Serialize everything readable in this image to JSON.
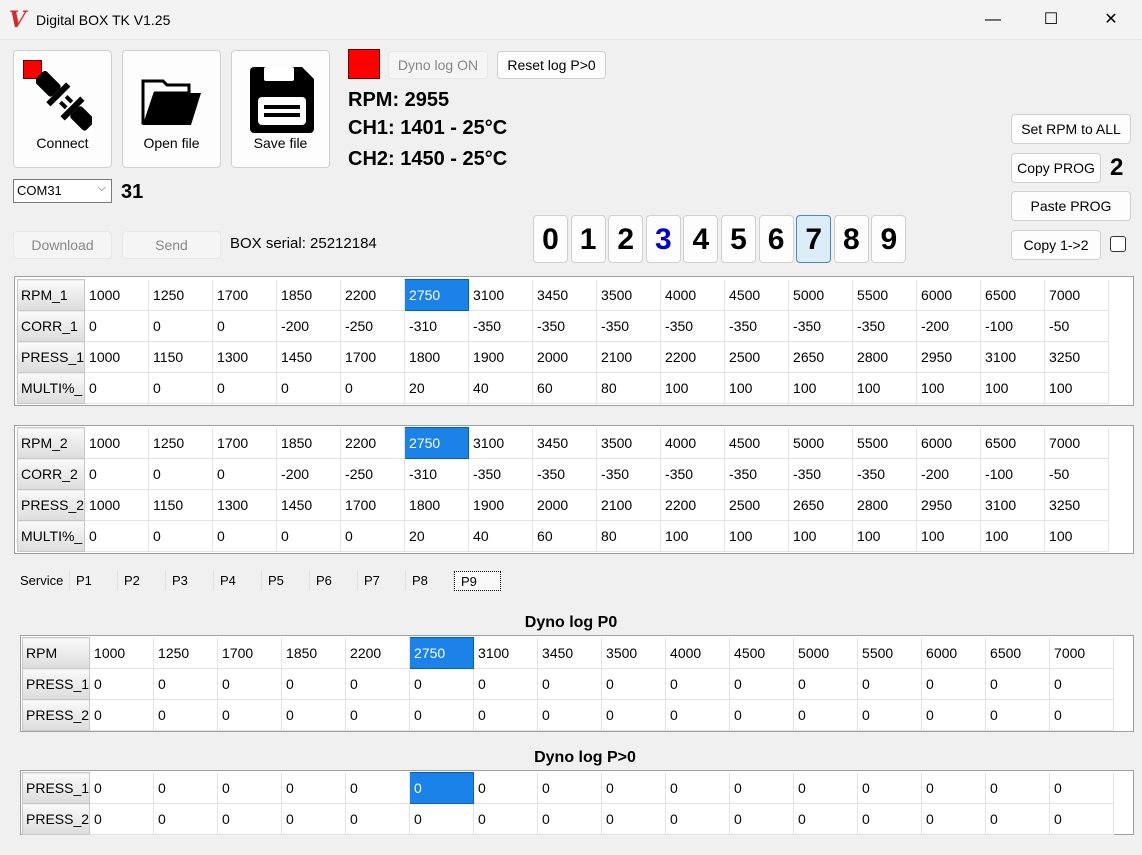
{
  "window": {
    "title": "Digital BOX TK V1.25",
    "logo": "V",
    "minimize": "—",
    "maximize": "☐",
    "close": "✕"
  },
  "toolbar": {
    "connect": "Connect",
    "open": "Open file",
    "save": "Save file",
    "com_port": "COM31",
    "com_number": "31",
    "download": "Download",
    "send": "Send",
    "box_serial": "BOX serial: 25212184",
    "connection_status_color": "#ff0000"
  },
  "status": {
    "dyno_log": "Dyno log ON",
    "reset_log": "Reset log P>0",
    "rpm": "RPM: 2955",
    "ch1": "CH1: 1401 - 25°C",
    "ch2": "CH2: 1450 - 25°C",
    "indicator_color": "#ff0000"
  },
  "right": {
    "set_rpm": "Set RPM to ALL",
    "copy_prog": "Copy PROG",
    "copied_prog": "2",
    "paste_prog": "Paste PROG",
    "copy12": "Copy 1->2",
    "copy12_checked": false
  },
  "programs": {
    "items": [
      "0",
      "1",
      "2",
      "3",
      "4",
      "5",
      "6",
      "7",
      "8",
      "9"
    ],
    "selected": "7",
    "highlighted": "3",
    "highlight_color": "#0000cc"
  },
  "table1": {
    "highlight_col": 5,
    "rows": [
      {
        "label": "RPM_1",
        "values": [
          "1000",
          "1250",
          "1700",
          "1850",
          "2200",
          "2750",
          "3100",
          "3450",
          "3500",
          "4000",
          "4500",
          "5000",
          "5500",
          "6000",
          "6500",
          "7000"
        ]
      },
      {
        "label": "CORR_1",
        "values": [
          "0",
          "0",
          "0",
          "-200",
          "-250",
          "-310",
          "-350",
          "-350",
          "-350",
          "-350",
          "-350",
          "-350",
          "-350",
          "-200",
          "-100",
          "-50"
        ]
      },
      {
        "label": "PRESS_1",
        "values": [
          "1000",
          "1150",
          "1300",
          "1450",
          "1700",
          "1800",
          "1900",
          "2000",
          "2100",
          "2200",
          "2500",
          "2650",
          "2800",
          "2950",
          "3100",
          "3250"
        ]
      },
      {
        "label": "MULTI%_",
        "values": [
          "0",
          "0",
          "0",
          "0",
          "0",
          "20",
          "40",
          "60",
          "80",
          "100",
          "100",
          "100",
          "100",
          "100",
          "100",
          "100"
        ]
      }
    ]
  },
  "table2": {
    "highlight_col": 5,
    "rows": [
      {
        "label": "RPM_2",
        "values": [
          "1000",
          "1250",
          "1700",
          "1850",
          "2200",
          "2750",
          "3100",
          "3450",
          "3500",
          "4000",
          "4500",
          "5000",
          "5500",
          "6000",
          "6500",
          "7000"
        ]
      },
      {
        "label": "CORR_2",
        "values": [
          "0",
          "0",
          "0",
          "-200",
          "-250",
          "-310",
          "-350",
          "-350",
          "-350",
          "-350",
          "-350",
          "-350",
          "-350",
          "-200",
          "-100",
          "-50"
        ]
      },
      {
        "label": "PRESS_2",
        "values": [
          "1000",
          "1150",
          "1300",
          "1450",
          "1700",
          "1800",
          "1900",
          "2000",
          "2100",
          "2200",
          "2500",
          "2650",
          "2800",
          "2950",
          "3100",
          "3250"
        ]
      },
      {
        "label": "MULTI%_",
        "values": [
          "0",
          "0",
          "0",
          "0",
          "0",
          "20",
          "40",
          "60",
          "80",
          "100",
          "100",
          "100",
          "100",
          "100",
          "100",
          "100"
        ]
      }
    ]
  },
  "tabs": {
    "items": [
      "Service",
      "P1",
      "P2",
      "P3",
      "P4",
      "P5",
      "P6",
      "P7",
      "P8",
      "P9"
    ],
    "selected": "P9"
  },
  "dyno0": {
    "title": "Dyno log  P0",
    "highlight_col": 5,
    "rows": [
      {
        "label": "RPM",
        "values": [
          "1000",
          "1250",
          "1700",
          "1850",
          "2200",
          "2750",
          "3100",
          "3450",
          "3500",
          "4000",
          "4500",
          "5000",
          "5500",
          "6000",
          "6500",
          "7000"
        ]
      },
      {
        "label": "PRESS_1",
        "values": [
          "0",
          "0",
          "0",
          "0",
          "0",
          "0",
          "0",
          "0",
          "0",
          "0",
          "0",
          "0",
          "0",
          "0",
          "0",
          "0"
        ]
      },
      {
        "label": "PRESS_2",
        "values": [
          "0",
          "0",
          "0",
          "0",
          "0",
          "0",
          "0",
          "0",
          "0",
          "0",
          "0",
          "0",
          "0",
          "0",
          "0",
          "0"
        ]
      }
    ]
  },
  "dyno1": {
    "title": "Dyno log  P>0",
    "highlight_row": 0,
    "highlight_col": 5,
    "rows": [
      {
        "label": "PRESS_1",
        "values": [
          "0",
          "0",
          "0",
          "0",
          "0",
          "0",
          "0",
          "0",
          "0",
          "0",
          "0",
          "0",
          "0",
          "0",
          "0",
          "0"
        ]
      },
      {
        "label": "PRESS_2",
        "values": [
          "0",
          "0",
          "0",
          "0",
          "0",
          "0",
          "0",
          "0",
          "0",
          "0",
          "0",
          "0",
          "0",
          "0",
          "0",
          "0"
        ]
      }
    ]
  }
}
